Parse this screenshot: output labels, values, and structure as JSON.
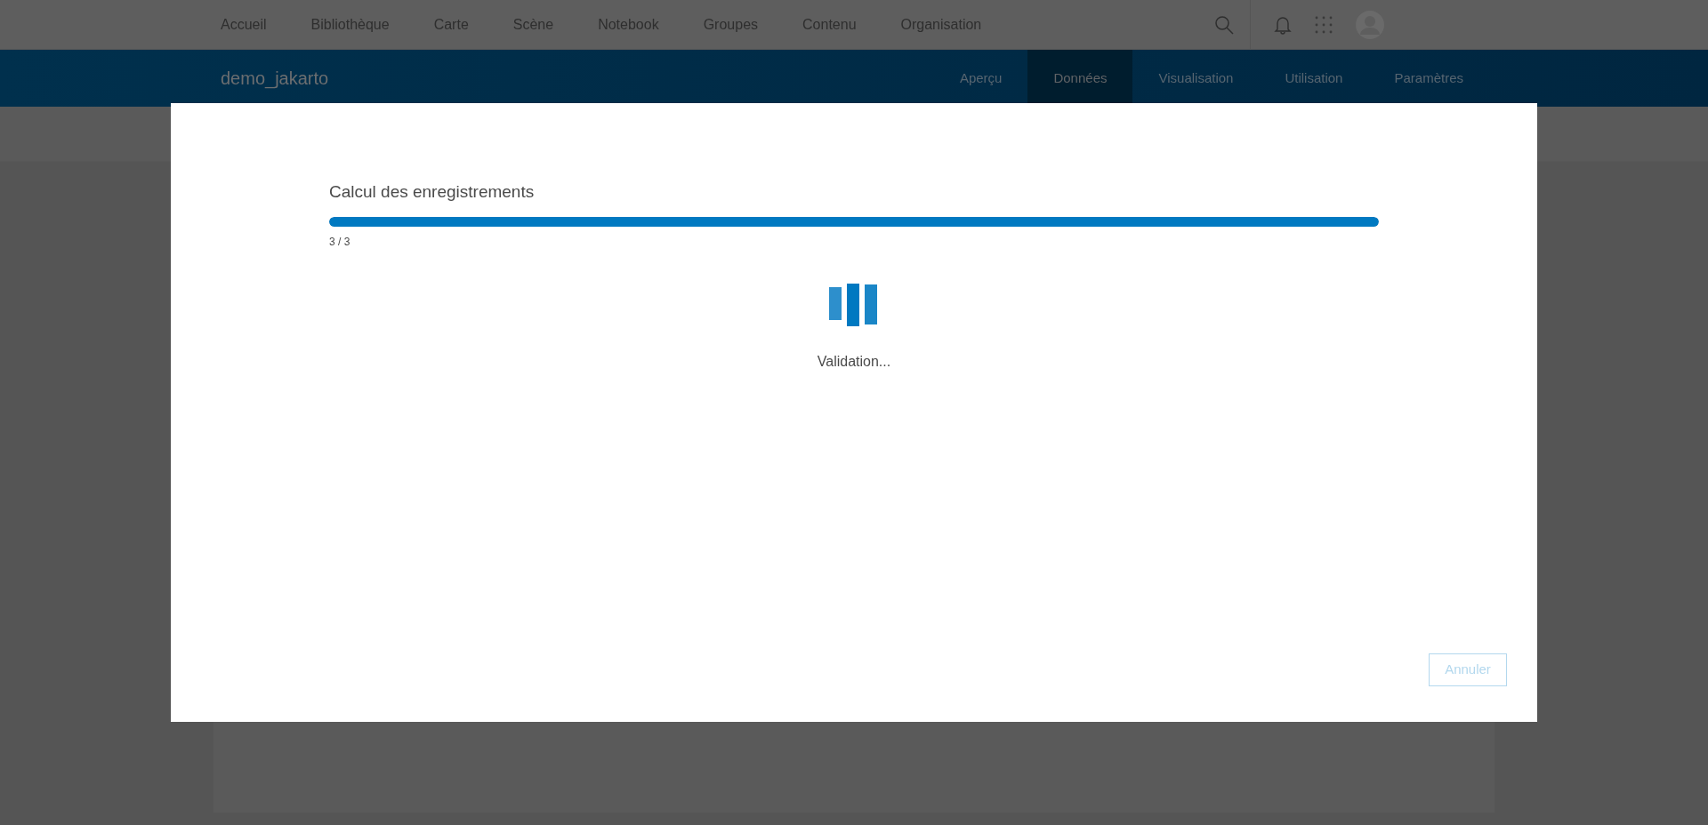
{
  "top_nav": {
    "items": [
      {
        "label": "Accueil"
      },
      {
        "label": "Bibliothèque"
      },
      {
        "label": "Carte"
      },
      {
        "label": "Scène"
      },
      {
        "label": "Notebook"
      },
      {
        "label": "Groupes"
      },
      {
        "label": "Contenu"
      },
      {
        "label": "Organisation"
      }
    ]
  },
  "item_header": {
    "title": "demo_jakarto",
    "tabs": [
      {
        "label": "Aperçu",
        "selected": false
      },
      {
        "label": "Données",
        "selected": true
      },
      {
        "label": "Visualisation",
        "selected": false
      },
      {
        "label": "Utilisation",
        "selected": false
      },
      {
        "label": "Paramètres",
        "selected": false
      }
    ]
  },
  "dialog": {
    "title": "Calcul des enregistrements",
    "progress": {
      "level": 1,
      "reading": "3 / 3"
    },
    "status": "Validation...",
    "cancel_button": {
      "label": "Annuler",
      "disabled": true
    }
  }
}
